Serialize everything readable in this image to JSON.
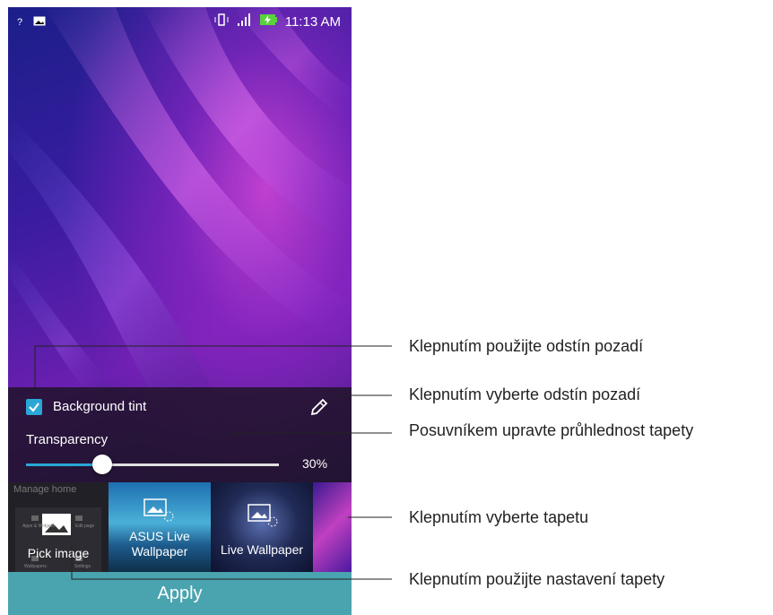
{
  "status_bar": {
    "time": "11:13 AM"
  },
  "wallpaper_settings": {
    "background_tint_label": "Background tint",
    "background_tint_checked": true,
    "transparency_label": "Transparency",
    "transparency_value": "30%",
    "transparency_fraction": 0.3
  },
  "wallpaper_picker": {
    "manage_home_label": "Manage home",
    "thumbnails": [
      {
        "label": "Pick image"
      },
      {
        "label": "ASUS Live\nWallpaper"
      },
      {
        "label": "Live Wallpaper"
      }
    ],
    "mini_labels": [
      "Apps & Widgets",
      "Edit page",
      "Wallpapers",
      "Settings"
    ]
  },
  "apply_label": "Apply",
  "callouts": [
    "Klepnutím použijte odstín pozadí",
    "Klepnutím vyberte odstín pozadí",
    "Posuvníkem upravte průhlednost tapety",
    "Klepnutím vyberte tapetu",
    "Klepnutím použijte nastavení tapety"
  ],
  "colors": {
    "accent": "#2aa7d6",
    "apply_bar": "#49a4b0"
  },
  "icons": [
    "question-wifi-icon",
    "image-notification-icon",
    "vibrate-icon",
    "signal-icon",
    "battery-charging-icon",
    "pencil-icon",
    "add-image-icon"
  ]
}
